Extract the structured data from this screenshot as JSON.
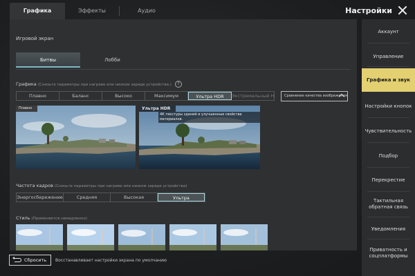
{
  "top_tabs": [
    "Графика",
    "Эффекты",
    "Аудио"
  ],
  "header": {
    "title": "Настройки"
  },
  "main": {
    "section_title": "Игровой экран",
    "mode_tabs": [
      "Битвы",
      "Лобби"
    ],
    "graphics": {
      "label": "Графика",
      "hint": "(Снизьте параметры при нагреве или низком заряде устройства.)",
      "help_icon": "?",
      "options": [
        "Плавно",
        "Баланс",
        "Высоко",
        "Максимум",
        "Ультра HDR",
        "Экстремальный HDR"
      ],
      "selected": "Ультра HDR",
      "compare_label": "Сравнение качества изображения"
    },
    "previews": [
      {
        "tag": "Плавно"
      },
      {
        "tag": "Ультра HDR",
        "description": "4К текстуры зданий и улучшенные свойства материалов."
      }
    ],
    "fps": {
      "label": "Частота кадров",
      "hint": "(Снизьте параметры при нагреве или низком заряде устройства)",
      "options": [
        "Энергосбережение",
        "Средняя",
        "Высокая",
        "Ультра"
      ],
      "selected": "Ультра"
    },
    "style": {
      "label": "Стиль",
      "hint": "(Применяется немедленно)",
      "thumbnail_count": 5,
      "selected_index": 0
    }
  },
  "bottom": {
    "reset_label": "Сбросить",
    "reset_hint": "Восстанавливает настройки экрана по умолчанию"
  },
  "sidebar": {
    "items": [
      "Аккаунт",
      "Управление",
      "Графика и звук",
      "Настройки кнопок",
      "Чувствительность",
      "Подбор",
      "Перекрестие",
      "Тактильная обратная связь",
      "Уведомления",
      "Приватность и соцплатформы"
    ],
    "active": "Графика и звук"
  },
  "colors": {
    "accent_yellow": "#e3d070",
    "selection_cyan": "#a9d6de",
    "panel": "#2e3032"
  }
}
